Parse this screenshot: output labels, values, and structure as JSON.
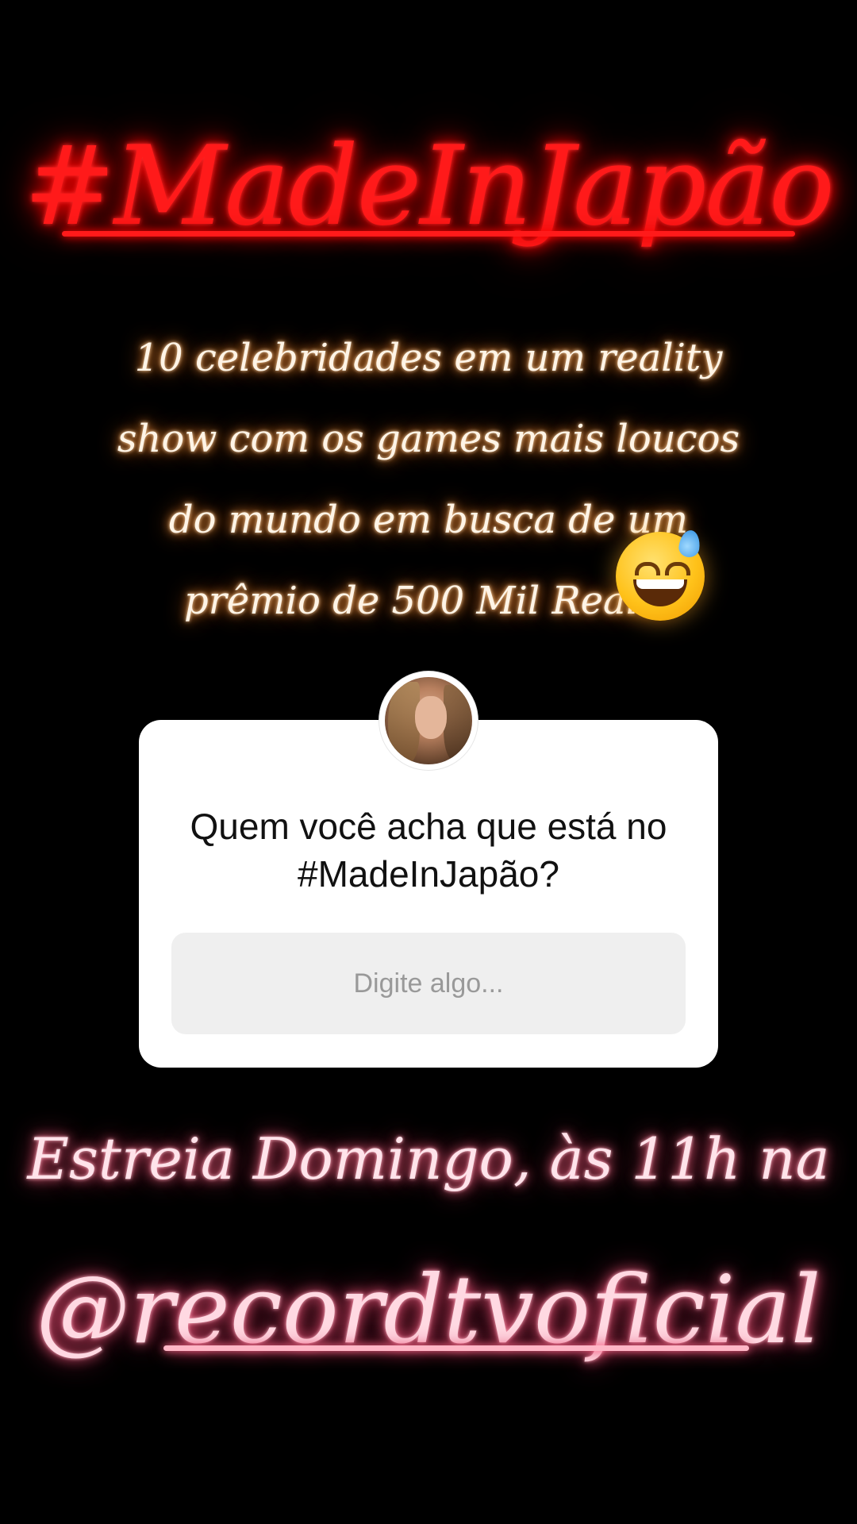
{
  "story": {
    "title_hashtag": "#MadeInJapão",
    "description": "10 celebridades em um reality show com os games mais loucos do mundo em busca de um prêmio de 500 Mil Reais!",
    "emoji_icon": "grinning-face-with-sweat",
    "premiere": "Estreia Domingo, às 11h na",
    "handle": "@recordtvoficial"
  },
  "question_sticker": {
    "question": "Quem você acha que está no #MadeInJapão?",
    "input_placeholder": "Digite algo..."
  },
  "colors": {
    "background": "#000000",
    "title_neon": "#ff1a1a",
    "description_neon": "#fff4e6",
    "bottom_neon": "#ffd9e2",
    "card": "#ffffff",
    "input": "#efefef"
  }
}
